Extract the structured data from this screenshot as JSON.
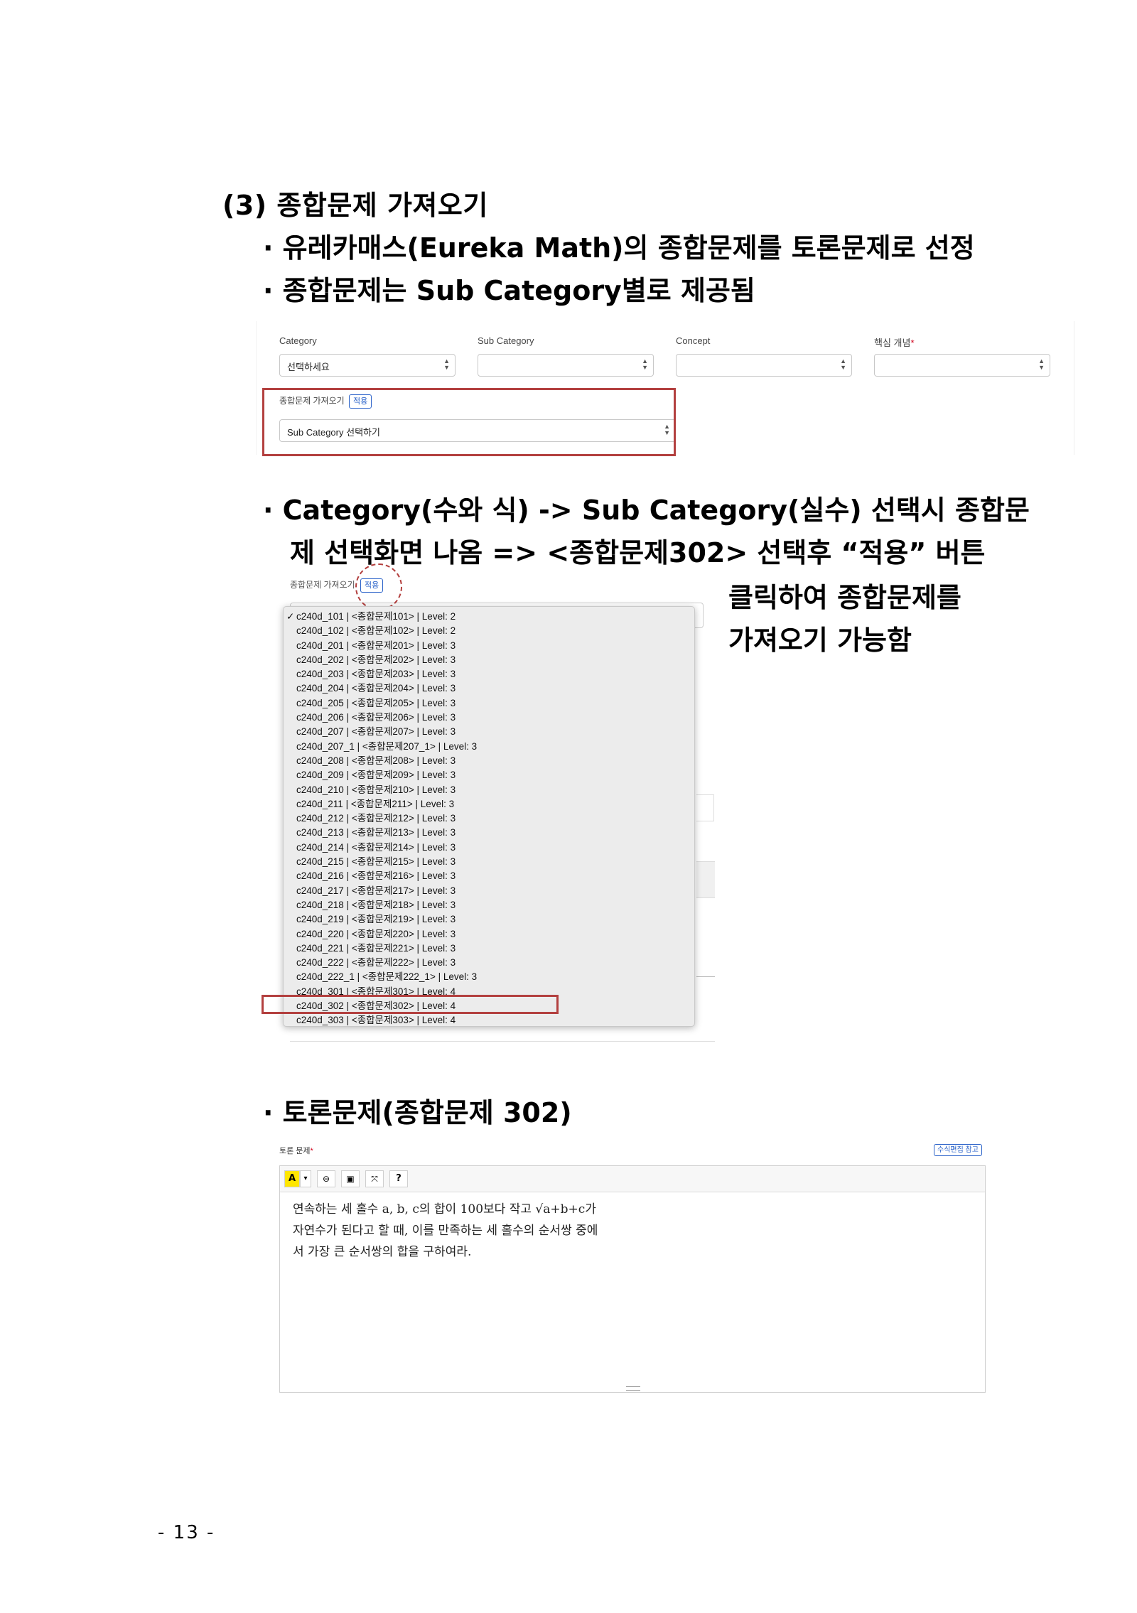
{
  "heading": "(3) 종합문제 가져오기",
  "bullets": [
    "· 유레카매스(Eureka Math)의 종합문제를 토론문제로 선정",
    "· 종합문제는 Sub Category별로 제공됨"
  ],
  "form": {
    "fields": [
      {
        "label": "Category",
        "value": "선택하세요",
        "required": false
      },
      {
        "label": "Sub Category",
        "value": "",
        "required": false
      },
      {
        "label": "Concept",
        "value": "",
        "required": false
      },
      {
        "label": "핵심 개념",
        "value": "",
        "required": true,
        "required_mark": "*"
      }
    ],
    "import_label": "종합문제 가져오기",
    "apply_label": "적용",
    "import_select": "Sub Category 선택하기"
  },
  "description": {
    "line1": "· Category(수와 식) -> Sub Category(실수) 선택시 종합문",
    "line2": "제 선택화면 나옴 => <종합문제302> 선택후 “적용” 버튼",
    "line3": "클릭하여 종합문제를",
    "line4": "가져오기 가능함"
  },
  "dropdown": {
    "label": "종합문제 가져오기",
    "apply_label": "적용",
    "checkmark": "✓",
    "selected_index": 23,
    "options": [
      "c240d_101 | <종합문제101> | Level: 2",
      "c240d_102 | <종합문제102> | Level: 2",
      "c240d_201 | <종합문제201> | Level: 3",
      "c240d_202 | <종합문제202> | Level: 3",
      "c240d_203 | <종합문제203> | Level: 3",
      "c240d_204 | <종합문제204> | Level: 3",
      "c240d_205 | <종합문제205> | Level: 3",
      "c240d_206 | <종합문제206> | Level: 3",
      "c240d_207 | <종합문제207> | Level: 3",
      "c240d_207_1 | <종합문제207_1> | Level: 3",
      "c240d_208 | <종합문제208> | Level: 3",
      "c240d_209 | <종합문제209> | Level: 3",
      "c240d_210 | <종합문제210> | Level: 3",
      "c240d_211 | <종합문제211> | Level: 3",
      "c240d_212 | <종합문제212> | Level: 3",
      "c240d_213 | <종합문제213> | Level: 3",
      "c240d_214 | <종합문제214> | Level: 3",
      "c240d_215 | <종합문제215> | Level: 3",
      "c240d_216 | <종합문제216> | Level: 3",
      "c240d_217 | <종합문제217> | Level: 3",
      "c240d_218 | <종합문제218> | Level: 3",
      "c240d_219 | <종합문제219> | Level: 3",
      "c240d_220 | <종합문제220> | Level: 3",
      "c240d_221 | <종합문제221> | Level: 3",
      "c240d_222 | <종합문제222> | Level: 3",
      "c240d_222_1 | <종합문제222_1> | Level: 3",
      "c240d_301 | <종합문제301> | Level: 4",
      "c240d_302 | <종합문제302> | Level: 4",
      "c240d_303 | <종합문제303> | Level: 4"
    ]
  },
  "section2": {
    "heading": "· 토론문제(종합문제 302)"
  },
  "editor": {
    "label": "토론 문제",
    "required_mark": "*",
    "help_button": "수식편집 참고",
    "toolbar": {
      "highlight": "A",
      "dropdown": "▾",
      "link": "⊖",
      "image": "▣",
      "fullscreen": "⤧",
      "help": "?"
    },
    "lines": [
      "연속하는 세 홀수 a, b, c의 합이 100보다 작고 √a+b+c가",
      "자연수가 된다고 할 때, 이를 만족하는 세 홀수의 순서쌍 중에",
      "서 가장 큰 순서쌍의 합을 구하여라."
    ]
  },
  "colors": {
    "highlight_box": "#b3403f",
    "link_blue": "#2a62c9",
    "required_red": "#d0021b"
  },
  "footer": {
    "page_number": "- 13 -"
  }
}
